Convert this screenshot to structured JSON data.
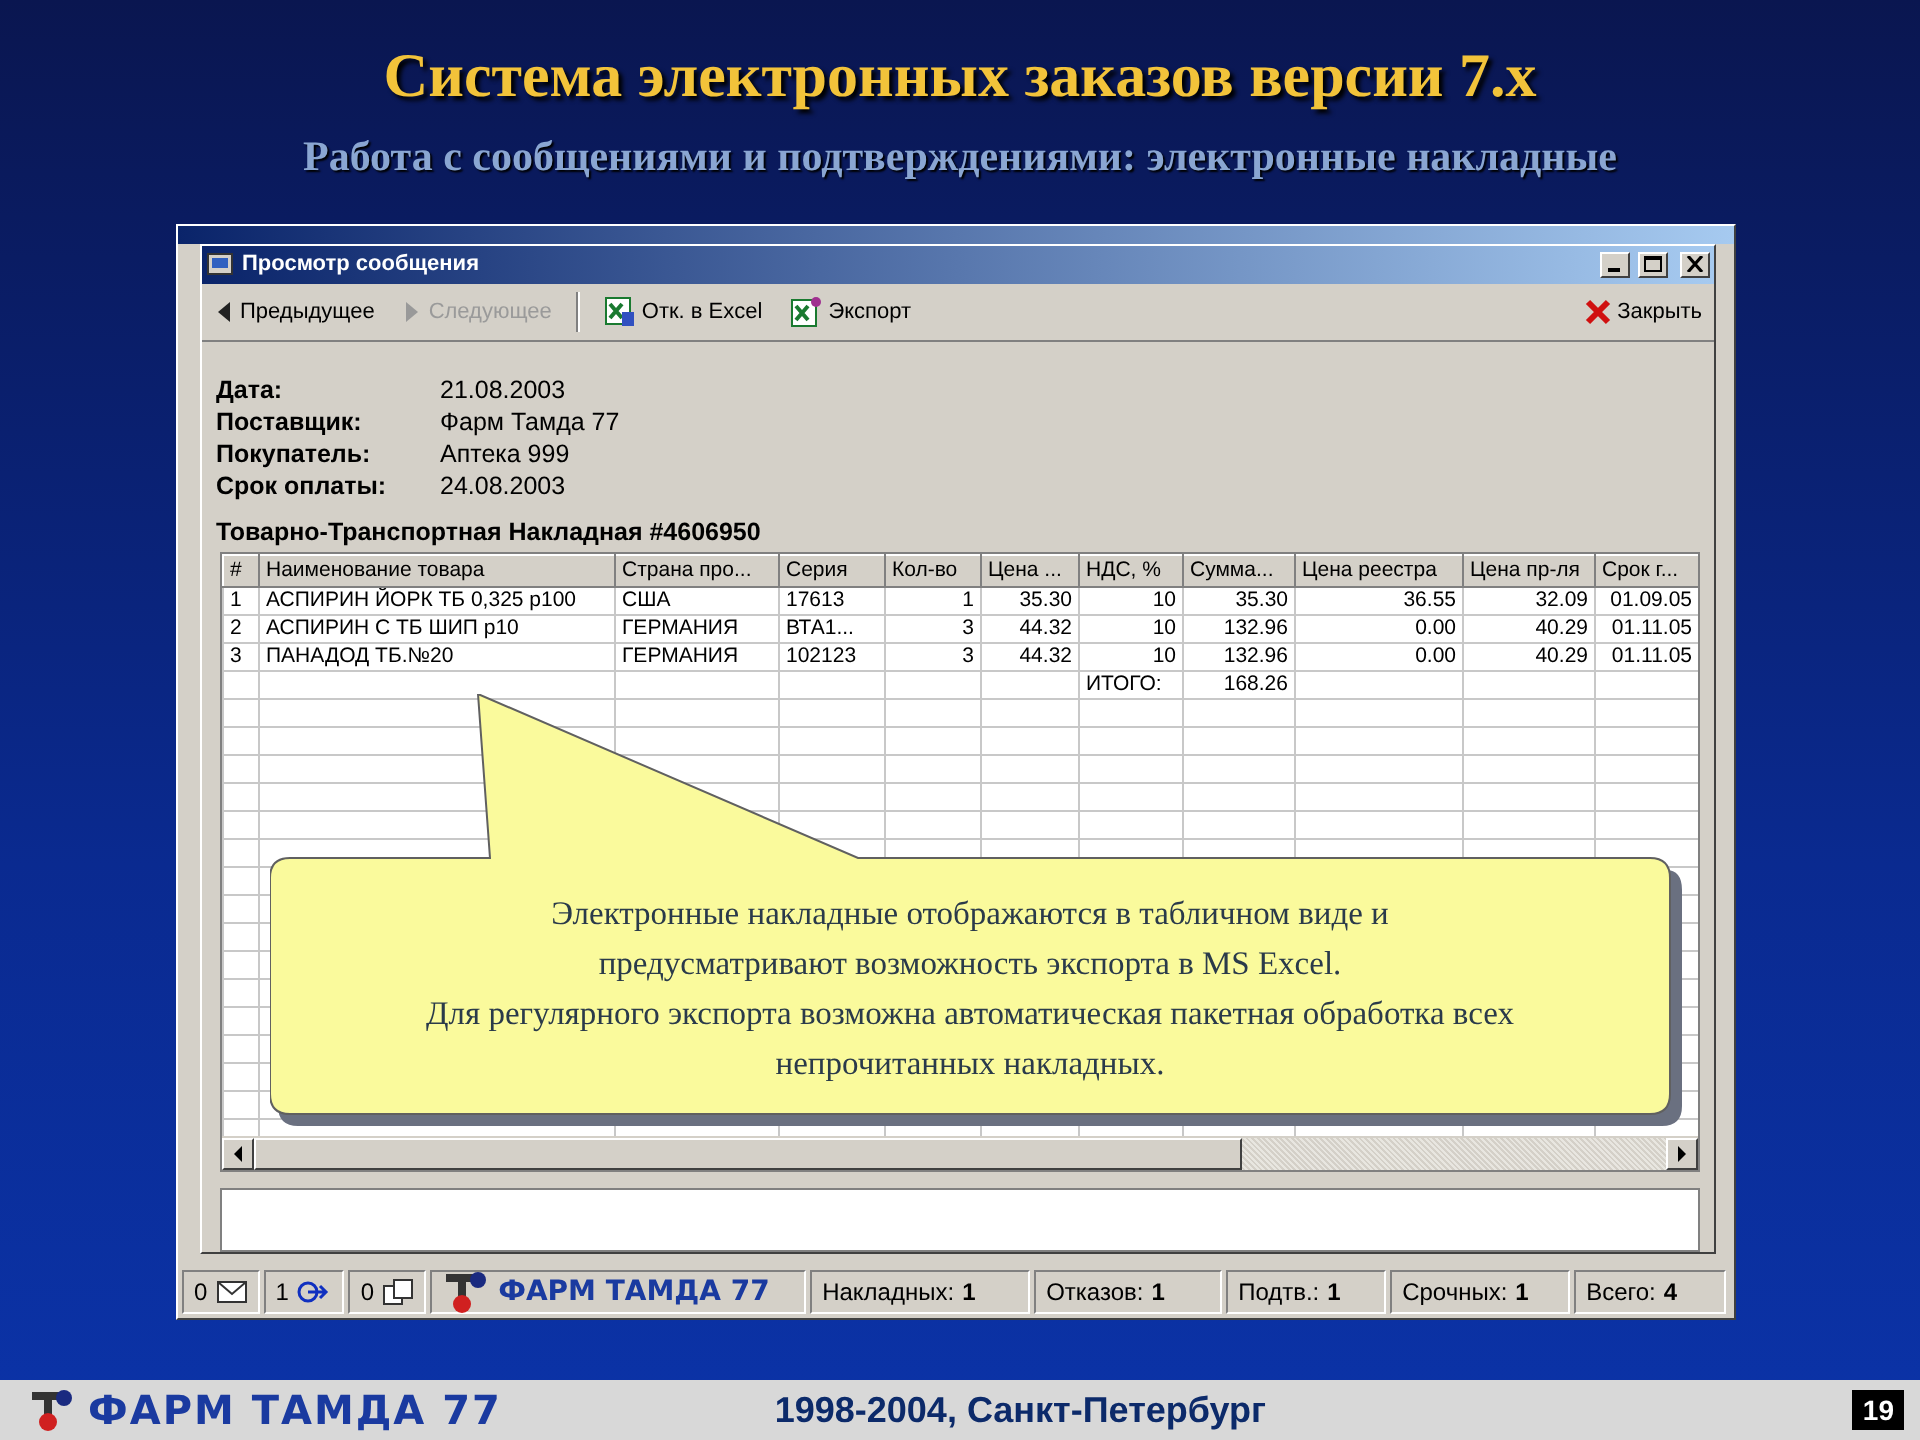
{
  "slide": {
    "title": "Система электронных заказов версии 7.x",
    "subtitle": "Работа с сообщениями и подтверждениями: электронные накладные"
  },
  "window": {
    "title": "Просмотр сообщения",
    "toolbar": [
      {
        "label": "Предыдущее",
        "disabled": false
      },
      {
        "label": "Следующее",
        "disabled": true
      },
      {
        "label": "Отк. в Excel",
        "disabled": false
      },
      {
        "label": "Экспорт",
        "disabled": false
      }
    ],
    "close_button": "Закрыть",
    "fields": [
      {
        "label": "Дата:",
        "value": "21.08.2003"
      },
      {
        "label": "Поставщик:",
        "value": "Фарм Тамда 77"
      },
      {
        "label": "Покупатель:",
        "value": "Аптека 999"
      },
      {
        "label": "Срок оплаты:",
        "value": "24.08.2003"
      }
    ],
    "document_title": "Товарно-Транспортная Накладная #4606950",
    "table": {
      "columns": [
        "#",
        "Наименование товара",
        "Страна про...",
        "Серия",
        "Кол-во",
        "Цена ...",
        "НДС, %",
        "Сумма...",
        "Цена реестра",
        "Цена пр-ля",
        "Срок г..."
      ],
      "rows": [
        [
          "1",
          "АСПИРИН ЙОРК ТБ 0,325 р100",
          "США",
          "17613",
          "1",
          "35.30",
          "10",
          "35.30",
          "36.55",
          "32.09",
          "01.09.05"
        ],
        [
          "2",
          "АСПИРИН С ТБ ШИП р10",
          "ГЕРМАНИЯ",
          "ВТА1...",
          "3",
          "44.32",
          "10",
          "132.96",
          "0.00",
          "40.29",
          "01.11.05"
        ],
        [
          "3",
          "ПАНАДОД ТБ.№20",
          "ГЕРМАНИЯ",
          "102123",
          "3",
          "44.32",
          "10",
          "132.96",
          "0.00",
          "40.29",
          "01.11.05"
        ]
      ],
      "total": {
        "label": "ИТОГО:",
        "value": "168.26"
      }
    }
  },
  "callout": {
    "paragraphs": [
      "Электронные накладные отображаются в табличном виде и предусматривают возможность экспорта в MS Excel.",
      "Для регулярного экспорта возможна автоматическая пакетная обработка всех непрочитанных накладных."
    ]
  },
  "status_bar": {
    "counters": [
      {
        "value": "0"
      },
      {
        "value": "1"
      },
      {
        "value": "0"
      }
    ],
    "logo": "ФАРМ ТАМДА 77",
    "stats": [
      {
        "label": "Накладных:",
        "value": "1"
      },
      {
        "label": "Отказов:",
        "value": "1"
      },
      {
        "label": "Подтв.:",
        "value": "1"
      },
      {
        "label": "Срочных:",
        "value": "1"
      },
      {
        "label": "Всего:",
        "value": "4"
      }
    ]
  },
  "footer": {
    "logo": "ФАРМ ТАМДА 77",
    "caption": "1998-2004, Санкт-Петербург",
    "page": "19"
  }
}
